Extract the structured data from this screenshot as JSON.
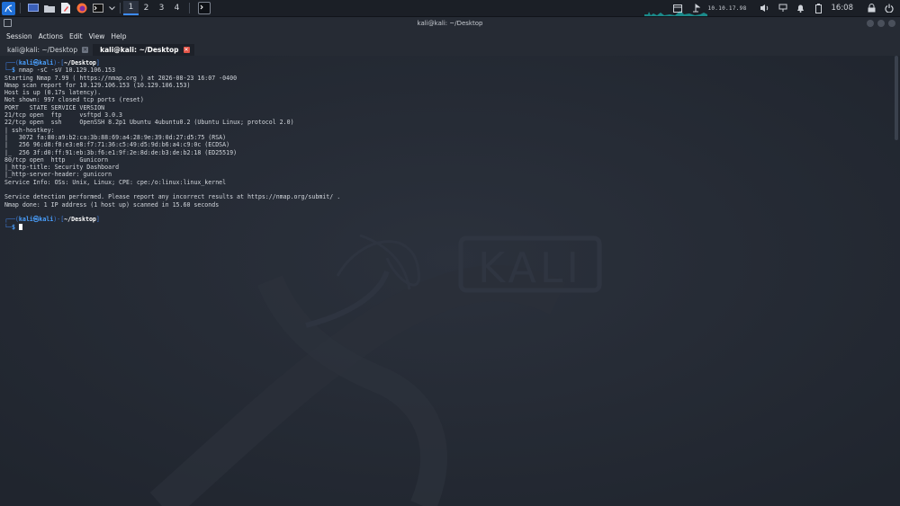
{
  "panel": {
    "workspaces": [
      "1",
      "2",
      "3",
      "4"
    ],
    "ip": "10.10.17.98",
    "clock": "16:08"
  },
  "window": {
    "title": "kali@kali: ~/Desktop"
  },
  "menu": [
    "Session",
    "Actions",
    "Edit",
    "View",
    "Help"
  ],
  "tabs": [
    {
      "label": "kali@kali: ~/Desktop",
      "active": false
    },
    {
      "label": "kali@kali: ~/Desktop",
      "active": true
    }
  ],
  "terminal": {
    "prompt_user": "kali㉿kali",
    "prompt_dir": "~/Desktop",
    "command": "nmap -sC -sV 10.129.106.153",
    "output": [
      "Starting Nmap 7.99 ( https://nmap.org ) at 2026-08-23 16:07 -0400",
      "Nmap scan report for 10.129.106.153 (10.129.106.153)",
      "Host is up (0.17s latency).",
      "Not shown: 997 closed tcp ports (reset)",
      "PORT   STATE SERVICE VERSION",
      "21/tcp open  ftp     vsftpd 3.0.3",
      "22/tcp open  ssh     OpenSSH 8.2p1 Ubuntu 4ubuntu0.2 (Ubuntu Linux; protocol 2.0)",
      "| ssh-hostkey:",
      "|   3072 fa:80:a9:b2:ca:3b:88:69:a4:28:9e:39:0d:27:d5:75 (RSA)",
      "|   256 96:d8:f8:e3:e8:f7:71:36:c5:49:d5:9d:b6:a4:c9:0c (ECDSA)",
      "|_  256 3f:d0:ff:91:eb:3b:f6:e1:9f:2e:8d:de:b3:de:b2:18 (ED25519)",
      "80/tcp open  http    Gunicorn",
      "|_http-title: Security Dashboard",
      "|_http-server-header: gunicorn",
      "Service Info: OSs: Unix, Linux; CPE: cpe:/o:linux:linux_kernel",
      "",
      "Service detection performed. Please report any incorrect results at https://nmap.org/submit/ .",
      "Nmap done: 1 IP address (1 host up) scanned in 15.60 seconds"
    ]
  },
  "wallpaper": {
    "logo_text": "KALI"
  },
  "colors": {
    "accent": "#3d8bff",
    "terminal_bg": "#242a34",
    "close_tab": "#e55548"
  }
}
